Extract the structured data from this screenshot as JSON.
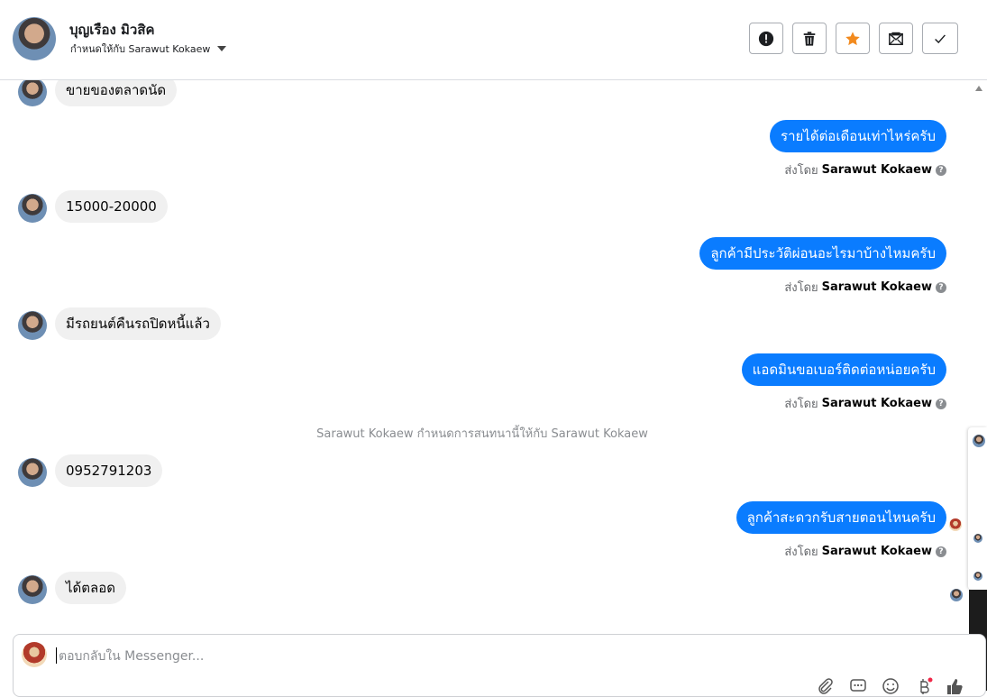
{
  "header": {
    "contact_name": "บุญเรือง มิวสิค",
    "assigned_text": "กำหนดให้กับ Sarawut Kokaew"
  },
  "toolbar": {
    "spam": "spam-icon",
    "delete": "trash-icon",
    "star": "star-icon",
    "mark_unread": "envelope-icon",
    "done": "check-icon"
  },
  "messages": {
    "m1": "ขายของตลาดนัด",
    "m2": "รายได้ต่อเดือนเท่าไหร่ครับ",
    "m3": "15000-20000",
    "m4": "ลูกค้ามีประวัติผ่อนอะไรมาบ้างไหมครับ",
    "m5": "มีรถยนต์คืนรถปิดหนี้แล้ว",
    "m6": "แอดมินขอเบอร์ติดต่อหน่อยครับ",
    "m7": "0952791203",
    "m8": "ลูกค้าสะดวกรับสายตอนไหนครับ",
    "m9": "ได้ตลอด"
  },
  "sent_by": {
    "prefix": "ส่งโดย",
    "name": "Sarawut Kokaew",
    "help": "?"
  },
  "system_message": "Sarawut Kokaew กำหนดการสนทนานี้ให้กับ Sarawut Kokaew",
  "composer": {
    "placeholder": "ตอบกลับใน Messenger..."
  },
  "colors": {
    "outgoing_bubble": "#0a7cff",
    "incoming_bubble": "#f0f0f0",
    "star": "#f28a1e"
  }
}
